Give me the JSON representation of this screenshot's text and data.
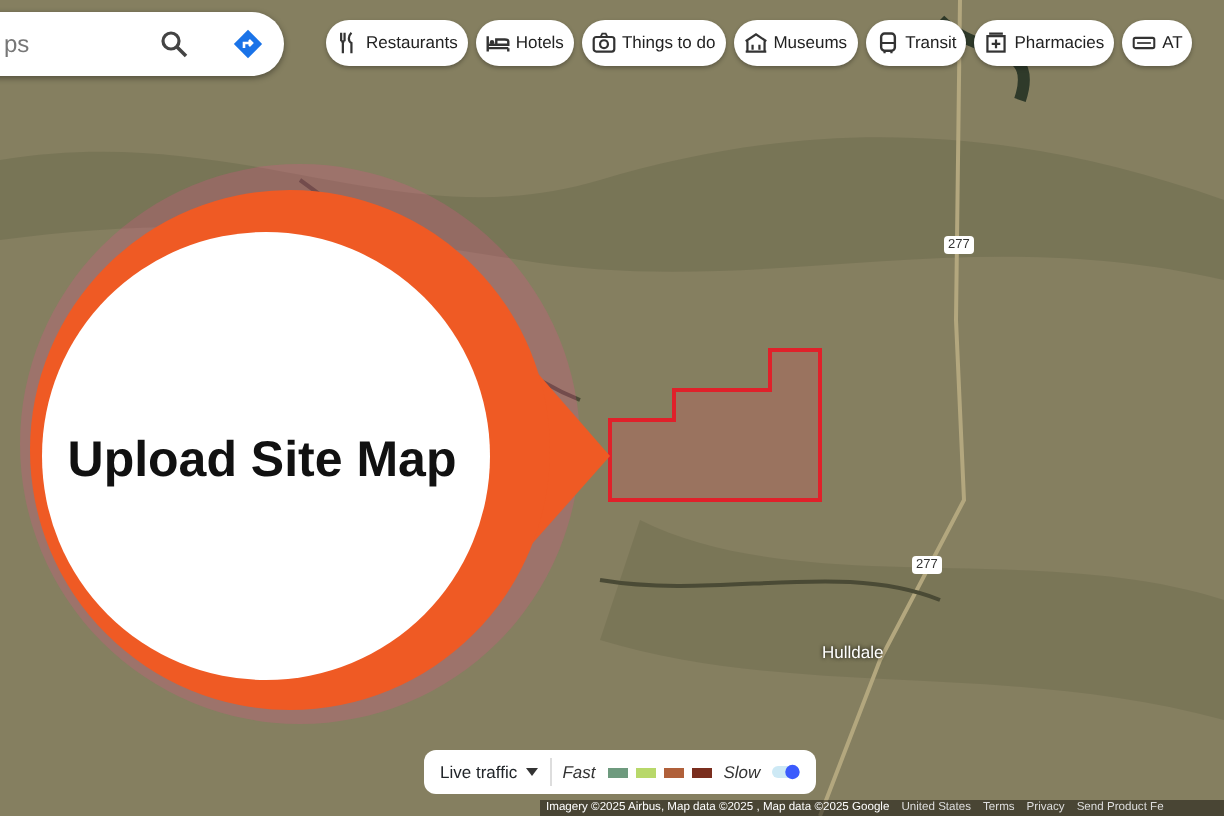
{
  "search": {
    "placeholder": "ps"
  },
  "chips": [
    {
      "label": "Restaurants"
    },
    {
      "label": "Hotels"
    },
    {
      "label": "Things to do"
    },
    {
      "label": "Museums"
    },
    {
      "label": "Transit"
    },
    {
      "label": "Pharmacies"
    },
    {
      "label": "AT"
    }
  ],
  "map": {
    "labels": [
      {
        "kind": "shield",
        "text": "277"
      },
      {
        "kind": "shield",
        "text": "277"
      },
      {
        "kind": "place",
        "text": "Hulldale"
      }
    ]
  },
  "callout": {
    "text": "Upload Site Map"
  },
  "traffic": {
    "label": "Live traffic",
    "fast": "Fast",
    "slow": "Slow",
    "legend": [
      {
        "color": "#6e9a7e"
      },
      {
        "color": "#b8d86a"
      },
      {
        "color": "#b0603a"
      },
      {
        "color": "#7a2e1e"
      }
    ],
    "on": true
  },
  "footer": {
    "attribution": "Imagery ©2025 Airbus, Map data ©2025 , Map data ©2025 Google",
    "links": [
      "United States",
      "Terms",
      "Privacy",
      "Send Product Fe"
    ]
  }
}
